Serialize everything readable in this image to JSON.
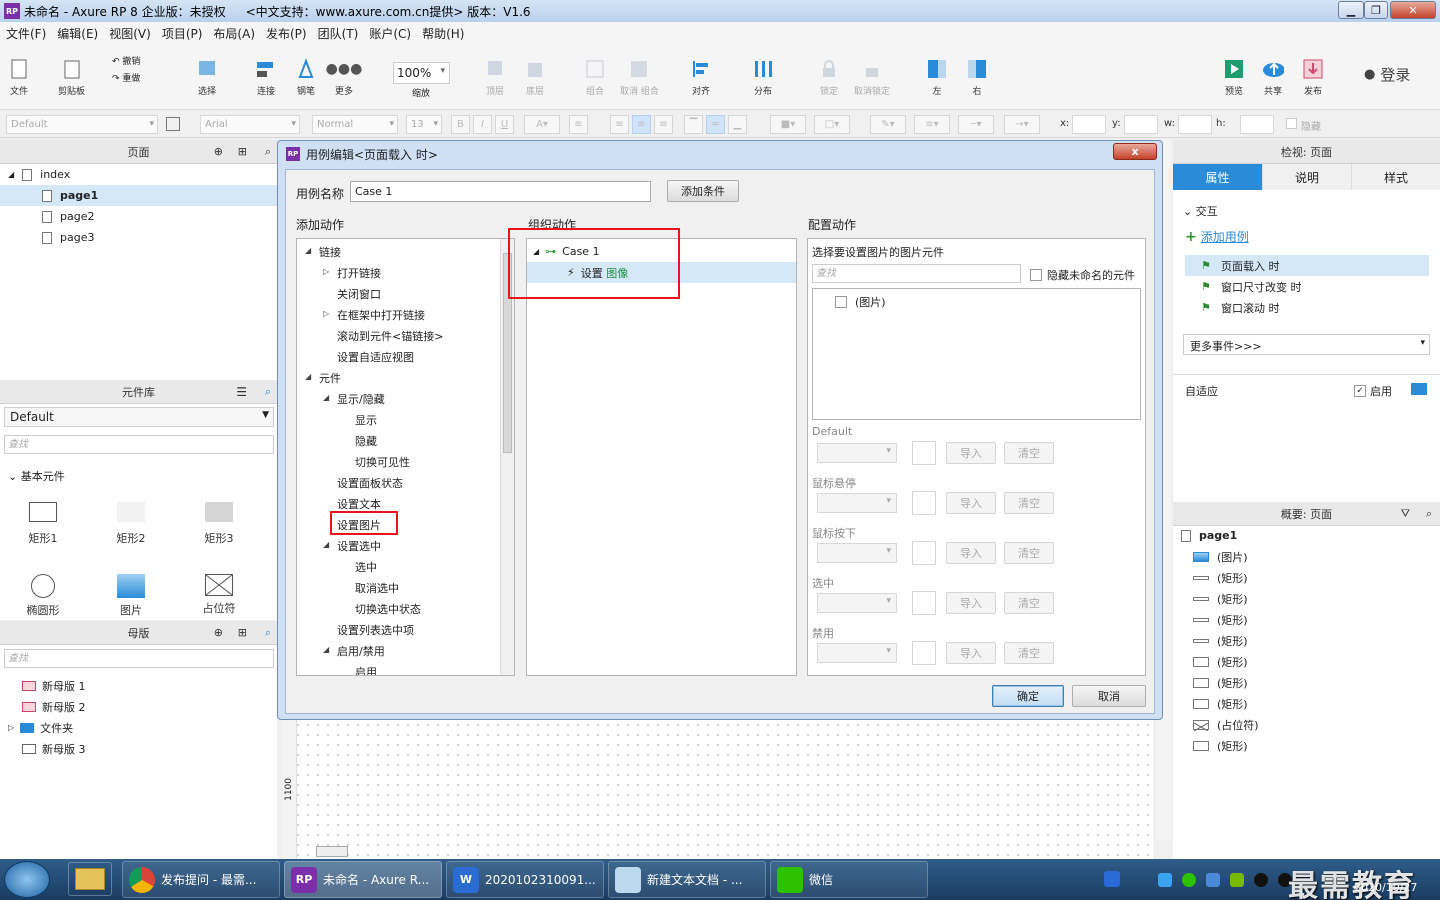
{
  "window": {
    "title": "未命名 - Axure RP 8 企业版：未授权",
    "support": "<中文支持：www.axure.com.cn提供> 版本：V1.6",
    "app_badge": "RP"
  },
  "menu": [
    "文件(F)",
    "编辑(E)",
    "视图(V)",
    "项目(P)",
    "布局(A)",
    "发布(P)",
    "团队(T)",
    "账户(C)",
    "帮助(H)"
  ],
  "toolbar": {
    "file": "文件",
    "clipboard": "剪贴板",
    "undo": "撤销",
    "redo": "重做",
    "select": "选择",
    "connect": "连接",
    "pen": "钢笔",
    "more": "更多",
    "zoom_value": "100%",
    "zoom_label": "缩放",
    "top": "顶层",
    "bottom": "底层",
    "group": "组合",
    "ungroup": "取消 组合",
    "align": "对齐",
    "distribute": "分布",
    "lock": "锁定",
    "unlock": "取消锁定",
    "left": "左",
    "right": "右",
    "preview": "预览",
    "share": "共享",
    "publish": "发布",
    "login": "登录"
  },
  "format": {
    "style": "Default",
    "font": "Arial",
    "weight": "Normal",
    "size": "13",
    "x_label": "x:",
    "y_label": "y:",
    "w_label": "w:",
    "h_label": "h:",
    "hide": "隐藏"
  },
  "pages": {
    "title": "页面",
    "root": "index",
    "items": [
      "page1",
      "page2",
      "page3"
    ]
  },
  "library": {
    "title": "元件库",
    "selected": "Default",
    "search_placeholder": "查找",
    "group": "基本元件",
    "widgets": [
      "矩形1",
      "矩形2",
      "矩形3",
      "椭圆形",
      "图片",
      "占位符"
    ]
  },
  "masters": {
    "title": "母版",
    "search_placeholder": "查找",
    "items": [
      "新母版 1",
      "新母版 2",
      "文件夹",
      "新母版 3"
    ]
  },
  "dialog": {
    "title": "用例编辑<页面载入 时>",
    "close": "x",
    "case_name_label": "用例名称",
    "case_name_value": "Case 1",
    "add_condition": "添加条件",
    "add_action_header": "添加动作",
    "organize_header": "组织动作",
    "configure_header": "配置动作",
    "actions": [
      {
        "label": "链接",
        "level": 0,
        "expand": "open"
      },
      {
        "label": "打开链接",
        "level": 1,
        "expand": "closed"
      },
      {
        "label": "关闭窗口",
        "level": 1,
        "expand": ""
      },
      {
        "label": "在框架中打开链接",
        "level": 1,
        "expand": "closed"
      },
      {
        "label": "滚动到元件<锚链接>",
        "level": 1,
        "expand": ""
      },
      {
        "label": "设置自适应视图",
        "level": 1,
        "expand": ""
      },
      {
        "label": "元件",
        "level": 0,
        "expand": "open"
      },
      {
        "label": "显示/隐藏",
        "level": 1,
        "expand": "open"
      },
      {
        "label": "显示",
        "level": 2,
        "expand": ""
      },
      {
        "label": "隐藏",
        "level": 2,
        "expand": ""
      },
      {
        "label": "切换可见性",
        "level": 2,
        "expand": ""
      },
      {
        "label": "设置面板状态",
        "level": 1,
        "expand": ""
      },
      {
        "label": "设置文本",
        "level": 1,
        "expand": ""
      },
      {
        "label": "设置图片",
        "level": 1,
        "expand": ""
      },
      {
        "label": "设置选中",
        "level": 1,
        "expand": "open"
      },
      {
        "label": "选中",
        "level": 2,
        "expand": ""
      },
      {
        "label": "取消选中",
        "level": 2,
        "expand": ""
      },
      {
        "label": "切换选中状态",
        "level": 2,
        "expand": ""
      },
      {
        "label": "设置列表选中项",
        "level": 1,
        "expand": ""
      },
      {
        "label": "启用/禁用",
        "level": 1,
        "expand": "open"
      },
      {
        "label": "启用",
        "level": 2,
        "expand": ""
      }
    ],
    "case_label": "Case 1",
    "action_prefix": "设置",
    "action_target": "图像",
    "select_widget_label": "选择要设置图片的图片元件",
    "search_placeholder": "查找",
    "hide_unnamed": "隐藏未命名的元件",
    "widget_item": "(图片)",
    "states": [
      "Default",
      "鼠标悬停",
      "鼠标按下",
      "选中",
      "禁用"
    ],
    "import": "导入",
    "clear": "清空",
    "ok": "确定",
    "cancel": "取消"
  },
  "inspector": {
    "title": "检视: 页面",
    "tabs": [
      "属性",
      "说明",
      "样式"
    ],
    "interaction": "交互",
    "add_case": "添加用例",
    "events": [
      "页面载入 时",
      "窗口尺寸改变 时",
      "窗口滚动 时"
    ],
    "more_events": "更多事件>>>",
    "adaptive": "自适应",
    "enable": "启用"
  },
  "outline": {
    "title": "概要: 页面",
    "page": "page1",
    "items": [
      "(图片)",
      "(矩形)",
      "(矩形)",
      "(矩形)",
      "(矩形)",
      "(矩形)",
      "(矩形)",
      "(矩形)",
      "(占位符)",
      "(矩形)"
    ]
  },
  "canvas": {
    "ruler_value": "1100"
  },
  "taskbar": {
    "tasks": [
      "发布提问 - 最需...",
      "未命名 - Axure R...",
      "2020102310091...",
      "新建文本文档 - ...",
      "微信"
    ],
    "badge_rp": "RP",
    "badge_w": "W",
    "date": "2020/10/27",
    "watermark": "最需教育"
  },
  "colors": {
    "accent": "#2a8bd8",
    "highlight": "#e8141c",
    "green": "#1e8e3e"
  }
}
